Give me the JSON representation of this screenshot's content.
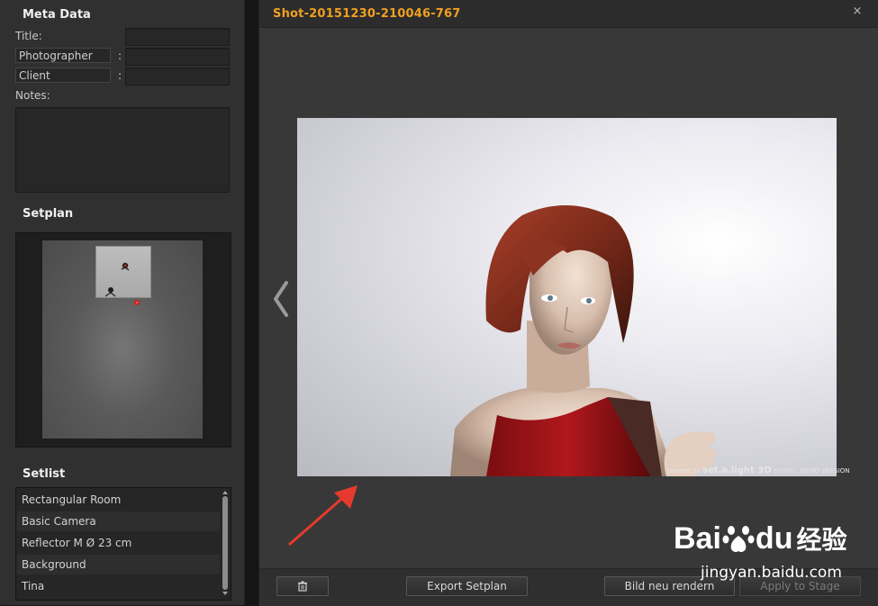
{
  "meta": {
    "section_title": "Meta Data",
    "title_label": "Title:",
    "photographer_label": "Photographer",
    "client_label": "Client",
    "colon": ":",
    "notes_label": "Notes:"
  },
  "setplan": {
    "section_title": "Setplan"
  },
  "setlist": {
    "section_title": "Setlist",
    "items": [
      "Rectangular Room",
      "Basic Camera",
      "Reflector M Ø 23 cm",
      "Background",
      "Tina"
    ]
  },
  "window": {
    "title": "Shot-20151230-210046-767",
    "close_glyph": "×",
    "title_color": "#f0a020"
  },
  "photo": {
    "watermark_prefix": "created by",
    "watermark_brand": "set.a.light 3D",
    "watermark_edition": "STUDIO",
    "watermark_demo": "DEMO VERSION"
  },
  "toolbar": {
    "delete_icon": "trash-icon",
    "export_label": "Export Setplan",
    "render_label": "Bild neu rendern",
    "apply_label": "Apply to Stage"
  },
  "overlay": {
    "baidu_latin_1": "Bai",
    "baidu_latin_2": "du",
    "baidu_chinese": "经验",
    "baidu_url": "jingyan.baidu.com"
  }
}
